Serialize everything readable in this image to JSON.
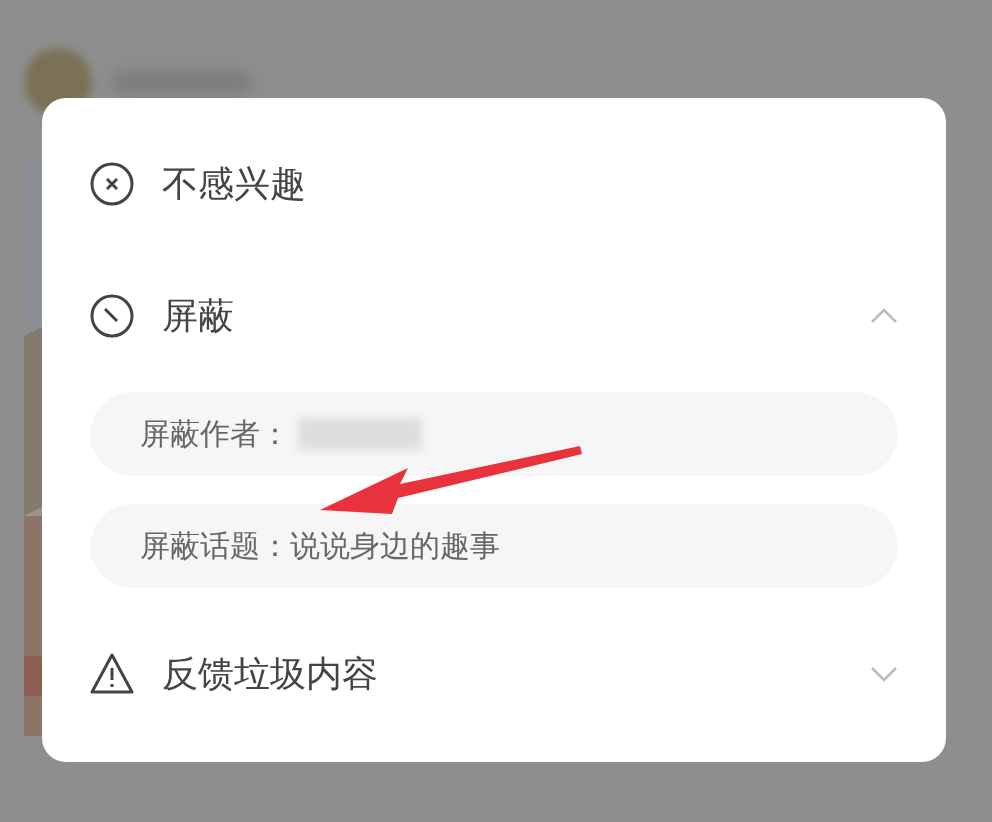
{
  "menu": {
    "items": [
      {
        "kind": "action",
        "label": "不感兴趣"
      },
      {
        "kind": "expandable",
        "label": "屏蔽",
        "expanded": true,
        "children": [
          {
            "label": "屏蔽作者：",
            "value_hidden": true
          },
          {
            "label": "屏蔽话题：说说身边的趣事",
            "value_hidden": false
          }
        ]
      },
      {
        "kind": "expandable",
        "label": "反馈垃圾内容",
        "expanded": false
      }
    ]
  }
}
